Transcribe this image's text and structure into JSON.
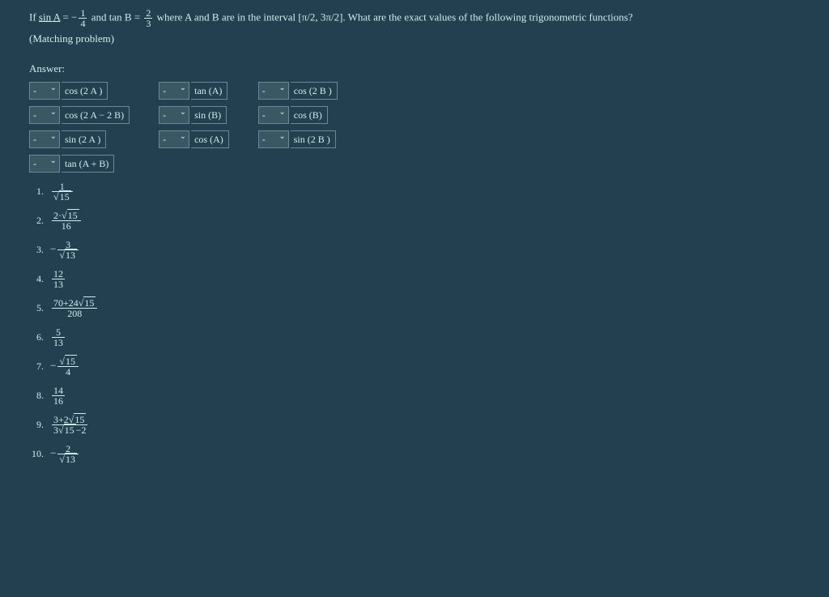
{
  "question": {
    "prefix": "If",
    "sinA_label": "sin A",
    "eq1": "=",
    "neg1": "−",
    "frac1_num": "1",
    "frac1_den": "4",
    "and": "and",
    "tanB_label": "tan B",
    "eq2": "=",
    "frac2_num": "2",
    "frac2_den": "3",
    "where": "where A and B are in the interval [π/2, 3π/2]. What are the exact values of the following trigonometric functions?",
    "sub": "(Matching problem)"
  },
  "answer_heading": "Answer:",
  "dropdown_placeholder": "-",
  "columns": [
    [
      "cos (2 A )",
      "cos (2 A − 2 B)",
      "sin (2 A )",
      "tan (A + B)"
    ],
    [
      "tan (A)",
      "sin (B)",
      "cos (A)"
    ],
    [
      "cos (2 B )",
      "cos (B)",
      "sin (2 B )"
    ]
  ],
  "key": {
    "1": {
      "type": "frac",
      "num": "1",
      "denSqrt": "15"
    },
    "2": {
      "type": "frac",
      "numPre": "2·",
      "numSqrt": "15",
      "den": "16"
    },
    "3": {
      "type": "negfrac",
      "num": "3",
      "denSqrt": "13"
    },
    "4": {
      "type": "frac",
      "num": "12",
      "den": "13"
    },
    "5": {
      "type": "frac",
      "numPre": "70+24",
      "numSqrt": "15",
      "den": "208"
    },
    "6": {
      "type": "frac",
      "num": "5",
      "den": "13"
    },
    "7": {
      "type": "negfrac",
      "numSqrt": "15",
      "den": "4"
    },
    "8": {
      "type": "frac",
      "num": "14",
      "den": "16"
    },
    "9": {
      "type": "frac",
      "numPre": "3+2",
      "numSqrt": "15",
      "denPre": "3",
      "denSqrt": "15",
      "denPost": "−2"
    },
    "10": {
      "type": "negfrac",
      "num": "2",
      "denSqrt": "13"
    }
  }
}
